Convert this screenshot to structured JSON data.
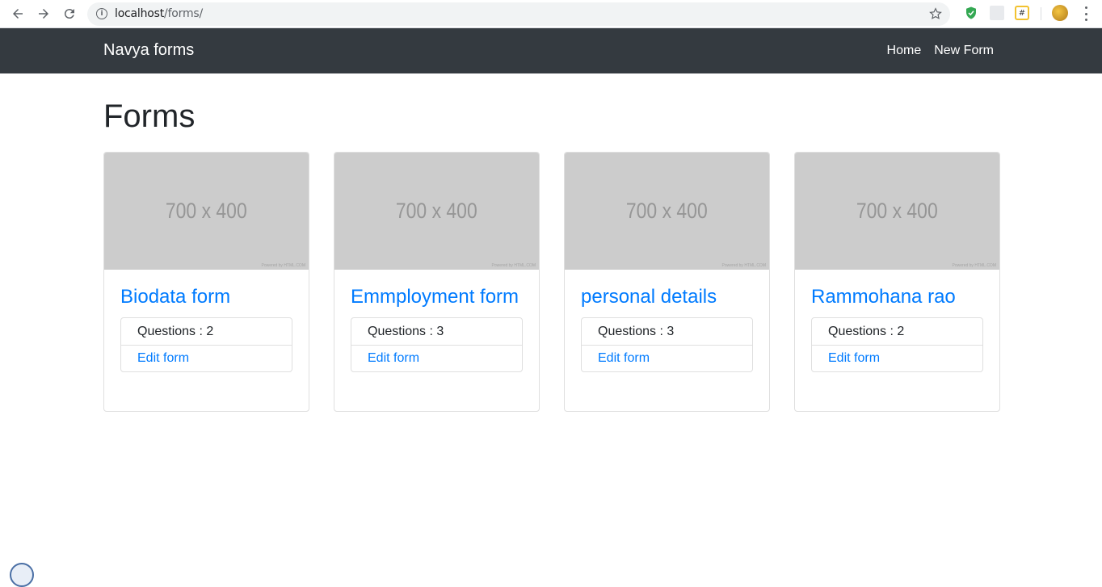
{
  "browser": {
    "url_host": "localhost",
    "url_path": "/forms/"
  },
  "navbar": {
    "brand": "Navya forms",
    "links": [
      "Home",
      "New Form"
    ]
  },
  "main": {
    "title": "Forms",
    "cards": [
      {
        "image_text": "700 x 400",
        "image_credit": "Powered by HTML.COM",
        "title": "Biodata form",
        "questions": "Questions : 2",
        "edit_label": "Edit form"
      },
      {
        "image_text": "700 x 400",
        "image_credit": "Powered by HTML.COM",
        "title": "Emmployment form",
        "questions": "Questions : 3",
        "edit_label": "Edit form"
      },
      {
        "image_text": "700 x 400",
        "image_credit": "Powered by HTML.COM",
        "title": "personal details",
        "questions": "Questions : 3",
        "edit_label": "Edit form"
      },
      {
        "image_text": "700 x 400",
        "image_credit": "Powered by HTML.COM",
        "title": "Rammohana rao",
        "questions": "Questions : 2",
        "edit_label": "Edit form"
      }
    ]
  },
  "colors": {
    "navbar_bg": "#343a40",
    "link": "#007bff",
    "placeholder_bg": "#cccccc"
  }
}
